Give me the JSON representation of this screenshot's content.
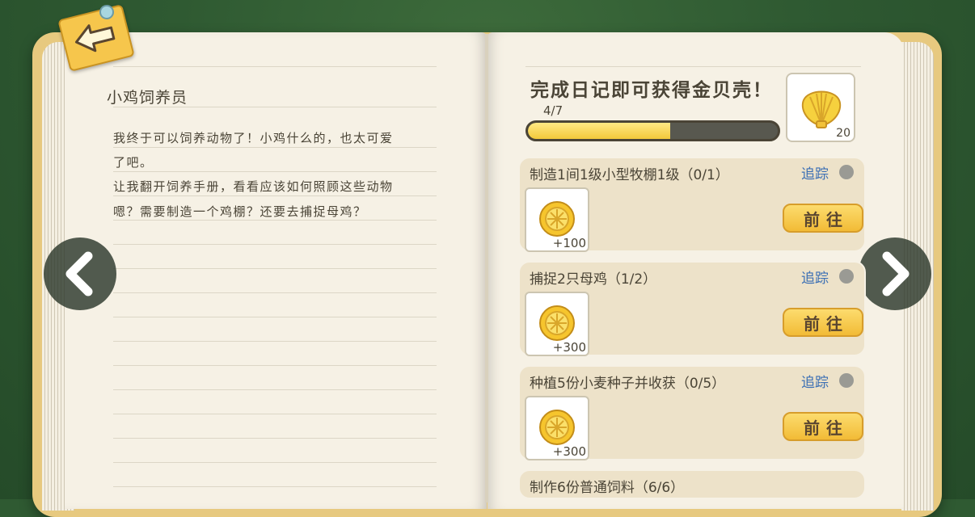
{
  "diary": {
    "title": "小鸡饲养员",
    "lines": [
      "我终于可以饲养动物了！小鸡什么的，也太可爱",
      "了吧。",
      "让我翻开饲养手册，看看应该如何照顾这些动物",
      "嗯？需要制造一个鸡棚？还要去捕捉母鸡？"
    ]
  },
  "reward": {
    "heading": "完成日记即可获得金贝壳！",
    "progress_text": "4/7",
    "progress_fraction": 0.571,
    "item_icon": "gold-shell-icon",
    "item_count": "20"
  },
  "tasks": [
    {
      "name": "制造1间1级小型牧棚1级（0/1）",
      "track": "追踪",
      "reward": "+100",
      "button": "前往",
      "icon": "gold-coin-icon"
    },
    {
      "name": "捕捉2只母鸡（1/2）",
      "track": "追踪",
      "reward": "+300",
      "button": "前往",
      "icon": "gold-coin-icon"
    },
    {
      "name": "种植5份小麦种子并收获（0/5）",
      "track": "追踪",
      "reward": "+300",
      "button": "前往",
      "icon": "gold-coin-icon"
    },
    {
      "name": "制作6份普通饲料（6/6）"
    }
  ],
  "colors": {
    "text": "#4a4436",
    "link": "#3b6fb4",
    "accent": "#f3c93a",
    "page": "#f6f1e5",
    "background": "#2f5a32"
  },
  "icons": {
    "back": "back-arrow-icon",
    "prev": "chevron-left-icon",
    "next": "chevron-right-icon"
  }
}
